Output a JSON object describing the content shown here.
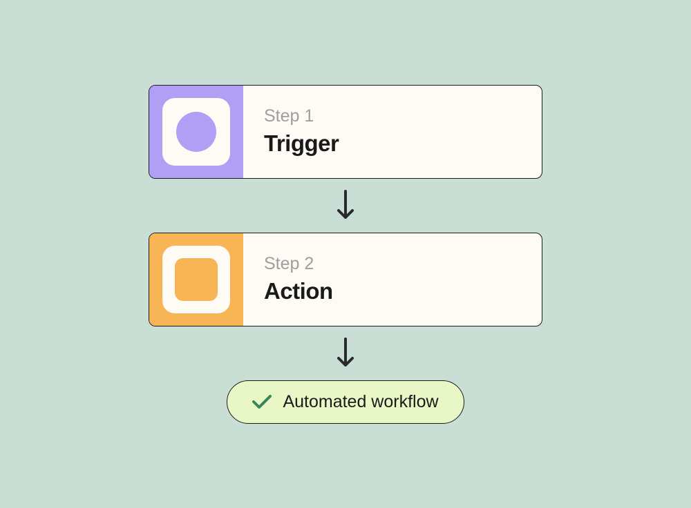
{
  "workflow": {
    "steps": [
      {
        "label": "Step 1",
        "title": "Trigger",
        "icon": "circle-icon",
        "color": "#b19ef5"
      },
      {
        "label": "Step 2",
        "title": "Action",
        "icon": "square-icon",
        "color": "#f7b556"
      }
    ],
    "result": {
      "label": "Automated workflow",
      "icon": "checkmark-icon",
      "checkColor": "#3a8554"
    }
  }
}
